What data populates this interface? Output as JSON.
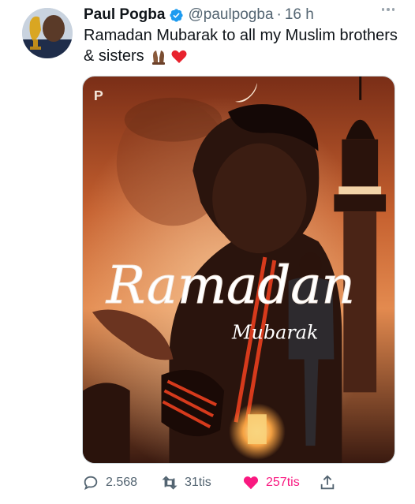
{
  "user": {
    "display_name": "Paul Pogba",
    "handle": "@paulpogba",
    "separator": "·",
    "time": "16 h",
    "verified": true
  },
  "tweet": {
    "text": "Ramadan Mubarak to all my Muslim brothers & sisters",
    "emojis": [
      "folded-hands",
      "red-heart"
    ]
  },
  "media": {
    "watermark_logo": "P",
    "title_text": "Ramadan",
    "subtitle_text": "Mubarak"
  },
  "actions": {
    "replies": "2.568",
    "retweets": "31tis",
    "likes": "257tis",
    "liked": true
  },
  "colors": {
    "verified_blue": "#1d9bf0",
    "like_pink": "#f91880",
    "muted_gray": "#536471",
    "text_black": "#0f1419"
  }
}
